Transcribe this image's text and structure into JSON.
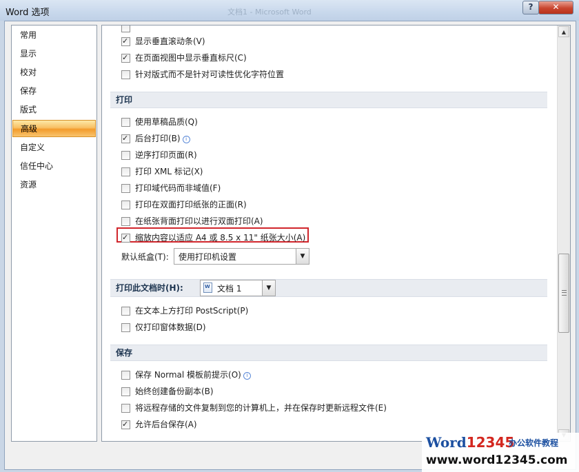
{
  "window": {
    "title": "Word 选项",
    "background_title": "文档1 - Microsoft Word",
    "help_label": "?",
    "close_label": "✕"
  },
  "nav": {
    "items": [
      {
        "label": "常用"
      },
      {
        "label": "显示"
      },
      {
        "label": "校对"
      },
      {
        "label": "保存"
      },
      {
        "label": "版式"
      },
      {
        "label": "高级",
        "active": true
      },
      {
        "label": "自定义"
      },
      {
        "label": "信任中心"
      },
      {
        "label": "资源"
      }
    ]
  },
  "display_options": [
    {
      "label": "显示垂直滚动条(V)",
      "checked": true
    },
    {
      "label": "在页面视图中显示垂直标尺(C)",
      "checked": true
    },
    {
      "label": "针对版式而不是针对可读性优化字符位置",
      "checked": false
    }
  ],
  "print_section": {
    "header": "打印",
    "options": [
      {
        "label": "使用草稿品质(Q)",
        "checked": false
      },
      {
        "label": "后台打印(B)",
        "checked": true,
        "info": true
      },
      {
        "label": "逆序打印页面(R)",
        "checked": false
      },
      {
        "label": "打印 XML 标记(X)",
        "checked": false
      },
      {
        "label": "打印域代码而非域值(F)",
        "checked": false
      },
      {
        "label": "打印在双面打印纸张的正面(R)",
        "checked": false
      },
      {
        "label": "在纸张背面打印以进行双面打印(A)",
        "checked": false
      },
      {
        "label": "缩放内容以适应 A4 或 8.5 x 11\" 纸张大小(A)",
        "checked": true
      }
    ],
    "tray_label": "默认纸盒(T):",
    "tray_value": "使用打印机设置"
  },
  "print_doc_section": {
    "header": "打印此文档时(H):",
    "doc_value": "文档 1",
    "options": [
      {
        "label": "在文本上方打印 PostScript(P)",
        "checked": false
      },
      {
        "label": "仅打印窗体数据(D)",
        "checked": false
      }
    ]
  },
  "save_section": {
    "header": "保存",
    "options": [
      {
        "label": "保存 Normal 模板前提示(O)",
        "checked": false,
        "info": true
      },
      {
        "label": "始终创建备份副本(B)",
        "checked": false
      },
      {
        "label": "将远程存储的文件复制到您的计算机上，并在保存时更新远程文件(E)",
        "checked": false
      },
      {
        "label": "允许后台保存(A)",
        "checked": true
      }
    ]
  },
  "watermark": {
    "brand_word": "Word",
    "brand_num": "12345",
    "tagline": "办公软件教程",
    "url": "www.word12345.com"
  }
}
